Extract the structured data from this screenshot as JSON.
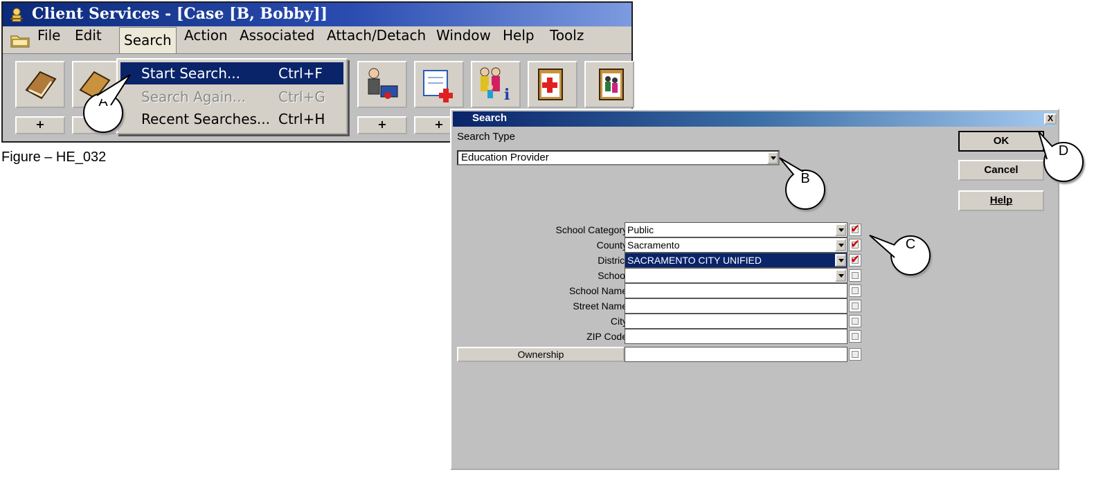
{
  "app": {
    "title": "Client Services - [Case [B, Bobby]]",
    "menu": [
      "File",
      "Edit",
      "Search",
      "Action",
      "Associated",
      "Attach/Detach",
      "Window",
      "Help",
      "Toolz"
    ],
    "plus_label": "+"
  },
  "search_menu": {
    "items": [
      {
        "label": "Start Search...",
        "shortcut": "Ctrl+F",
        "state": "active"
      },
      {
        "label": "Search Again...",
        "shortcut": "Ctrl+G",
        "state": "disabled"
      },
      {
        "label": "Recent Searches...",
        "shortcut": "Ctrl+H",
        "state": "normal"
      }
    ]
  },
  "figure_caption": "Figure – HE_032",
  "callouts": {
    "a": "A",
    "b": "B",
    "c": "C",
    "d": "D"
  },
  "dialog": {
    "title": "Search",
    "close": "X",
    "search_type_label": "Search Type",
    "search_type_value": "Education Provider",
    "buttons": {
      "ok": "OK",
      "cancel": "Cancel",
      "help": "Help"
    },
    "fields": [
      {
        "label": "School Category",
        "value": "Public",
        "dropdown": true,
        "checked": true
      },
      {
        "label": "County",
        "value": "Sacramento",
        "dropdown": true,
        "checked": true
      },
      {
        "label": "District",
        "value": "SACRAMENTO CITY UNIFIED",
        "dropdown": true,
        "checked": true
      },
      {
        "label": "School",
        "value": "",
        "dropdown": true,
        "checked": false
      },
      {
        "label": "School Name",
        "value": "",
        "dropdown": false,
        "checked": false
      },
      {
        "label": "Street Name",
        "value": "",
        "dropdown": false,
        "checked": false
      },
      {
        "label": "City",
        "value": "",
        "dropdown": false,
        "checked": false
      },
      {
        "label": "ZIP Code",
        "value": "",
        "dropdown": false,
        "checked": false
      }
    ],
    "ownership_label": "Ownership",
    "ownership_value": "",
    "check_glyph": "✔",
    "accent": "#0a246a",
    "check_color": "#d00000"
  }
}
